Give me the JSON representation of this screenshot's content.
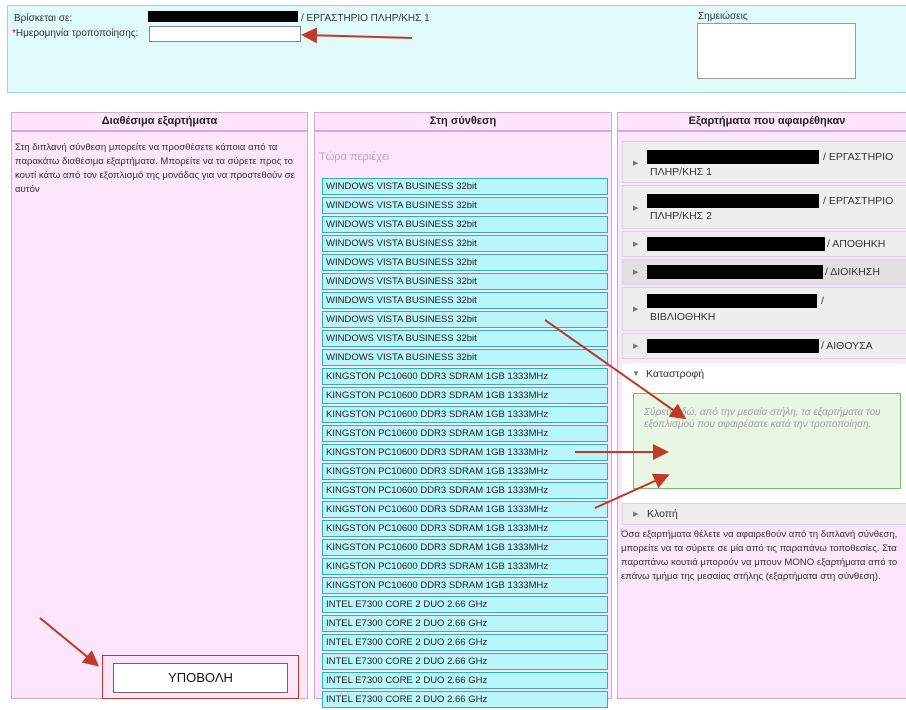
{
  "header": {
    "location_label": "Βρίσκεται σε:",
    "location_value": "/ ΕΡΓΑΣΤΗΡΙΟ ΠΛΗΡ/ΚΗΣ 1",
    "date_label": "Ημερομηνία τροποποίησης:",
    "date_required_mark": "*",
    "date_value": "",
    "notes_label": "Σημειώσεις",
    "notes_value": ""
  },
  "available": {
    "title": "Διαθέσιμα εξαρτήματα",
    "help_text": "Στη διπλανή σύνθεση μπορείτε να προσθέσετε κάποια από τα παρακάτω διαθέσιμα εξαρτήματα. Μπορείτε να τα σύρετε προς το κουτί κάτω από τον εξοπλισμό της μονάδας για να προστεθούν σε αυτόν",
    "submit_label": "ΥΠΟΒΟΛΗ"
  },
  "composition": {
    "title": "Στη σύνθεση",
    "now_label": "Τώρα περιέχει",
    "items": [
      "WINDOWS VISTA BUSINESS 32bit",
      "WINDOWS VISTA BUSINESS 32bit",
      "WINDOWS VISTA BUSINESS 32bit",
      "WINDOWS VISTA BUSINESS 32bit",
      "WINDOWS VISTA BUSINESS 32bit",
      "WINDOWS VISTA BUSINESS 32bit",
      "WINDOWS VISTA BUSINESS 32bit",
      "WINDOWS VISTA BUSINESS 32bit",
      "WINDOWS VISTA BUSINESS 32bit",
      "WINDOWS VISTA BUSINESS 32bit",
      "KINGSTON PC10600 DDR3 SDRAM 1GB 1333MHz",
      "KINGSTON PC10600 DDR3 SDRAM 1GB 1333MHz",
      "KINGSTON PC10600 DDR3 SDRAM 1GB 1333MHz",
      "KINGSTON PC10600 DDR3 SDRAM 1GB 1333MHz",
      "KINGSTON PC10600 DDR3 SDRAM 1GB 1333MHz",
      "KINGSTON PC10600 DDR3 SDRAM 1GB 1333MHz",
      "KINGSTON PC10600 DDR3 SDRAM 1GB 1333MHz",
      "KINGSTON PC10600 DDR3 SDRAM 1GB 1333MHz",
      "KINGSTON PC10600 DDR3 SDRAM 1GB 1333MHz",
      "KINGSTON PC10600 DDR3 SDRAM 1GB 1333MHz",
      "KINGSTON PC10600 DDR3 SDRAM 1GB 1333MHz",
      "KINGSTON PC10600 DDR3 SDRAM 1GB 1333MHz",
      "INTEL E7300 CORE 2 DUO 2.66 GHz",
      "INTEL E7300 CORE 2 DUO 2.66 GHz",
      "INTEL E7300 CORE 2 DUO 2.66 GHz",
      "INTEL E7300 CORE 2 DUO 2.66 GHz",
      "INTEL E7300 CORE 2 DUO 2.66 GHz",
      "INTEL E7300 CORE 2 DUO 2.66 GHz"
    ]
  },
  "removed": {
    "title": "Εξαρτήματα που αφαιρέθηκαν",
    "sections": [
      {
        "line1": "/ ΕΡΓΑΣΤΗΡΙΟ",
        "line2": "ΠΛΗΡ/ΚΗΣ 1"
      },
      {
        "line1": "/ ΕΡΓΑΣΤΗΡΙΟ",
        "line2": "ΠΛΗΡ/ΚΗΣ 2"
      },
      {
        "line1": "/ ΑΠΟΘΗΚΗ",
        "line2": ""
      },
      {
        "line1": "/ ΔΙΟΙΚΗΣΗ",
        "line2": ""
      },
      {
        "line1": "/",
        "line2": "ΒΙΒΛΙΟΘΗΚΗ"
      },
      {
        "line1": "/ ΑΙΘΟΥΣΑ",
        "line2": ""
      }
    ],
    "destruction_label": "Καταστροφή",
    "drop_hint": "Σύρετε εδώ, από την μεσαία στήλη, τα εξαρτήματα του εξοπλισμού που αφαιρέσατε κατά την τροποποίηση.",
    "theft_label": "Κλοπή",
    "help_text": "Όσα εξαρτήματα θέλετε να αφαιρεθούν από τη διπλανή σύνθεση, μπορείτε να τα σύρετε σε μία από τις παραπάνω τοποθεσίες. Στα παραπάνω κουτιά μπορούν να μπουν ΜΟΝΟ εξαρτήματα από το επάνω τμήμα της μεσαίας στήλης (εξαρτήματα στη σύνθεση)."
  },
  "colors": {
    "top_bg": "#e1fbfb",
    "column_bg": "#fde6fc",
    "item_bg": "#b9f6fa",
    "drop_bg": "#e9f6e4",
    "arrow": "#c0392b"
  }
}
